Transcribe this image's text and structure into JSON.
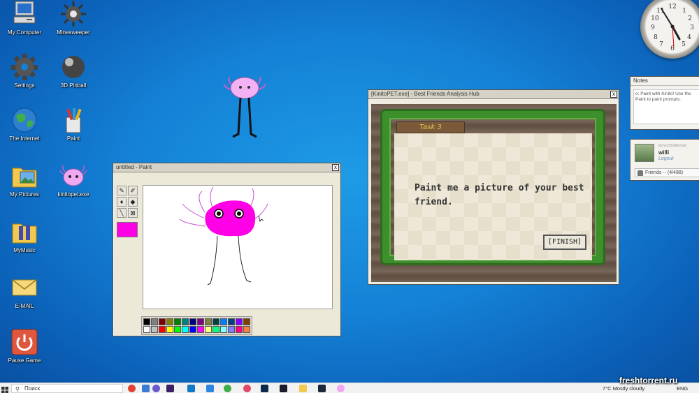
{
  "desktop_icons": [
    {
      "label": "My Computer",
      "icon": "computer-icon"
    },
    {
      "label": "Minesweeper",
      "icon": "mine-icon"
    },
    {
      "label": "Settings",
      "icon": "gear-icon"
    },
    {
      "label": "3D Pinball",
      "icon": "ball-icon"
    },
    {
      "label": "The Internet",
      "icon": "globe-icon"
    },
    {
      "label": "Paint",
      "icon": "paint-bucket-icon"
    },
    {
      "label": "My Pictures",
      "icon": "pictures-folder-icon"
    },
    {
      "label": "kinitopet.exe",
      "icon": "kinito-pet-icon"
    },
    {
      "label": "MyMusic",
      "icon": "music-folder-icon"
    },
    {
      "label": "E-MAIL",
      "icon": "envelope-icon"
    },
    {
      "label": "Pause Game",
      "icon": "power-icon"
    }
  ],
  "paint_window": {
    "title": "untitled - Paint",
    "close": "x",
    "current_color": "#ff00e6",
    "palette": [
      "#000000",
      "#808080",
      "#800000",
      "#808000",
      "#008000",
      "#008080",
      "#000080",
      "#800080",
      "#808040",
      "#004040",
      "#0080ff",
      "#004080",
      "#8000ff",
      "#804000",
      "#ffffff",
      "#c0c0c0",
      "#ff0000",
      "#ffff00",
      "#00ff00",
      "#00ffff",
      "#0000ff",
      "#ff00ff",
      "#ffff80",
      "#00ff80",
      "#80ffff",
      "#8080ff",
      "#ff0080",
      "#ff8040"
    ]
  },
  "kinito_window": {
    "title": "[KinitoPET.exe] - Best Friends Analysis Hub",
    "close": "x",
    "task_label": "Task 3",
    "prompt": "Paint me a picture of your best friend.",
    "finish_label": "[FINISH]"
  },
  "notes_widget": {
    "title": "Notes",
    "text": "o: Paint with Kinito! Use the Paint to paint prompts."
  },
  "friends_widget": {
    "user_small": "idmsx5528email",
    "username": "willi",
    "logout_label": "Logout",
    "friends_label": "Friends -- (4/488)"
  },
  "taskbar": {
    "search_placeholder": "Поиск",
    "weather": "7°C  Mostly cloudy",
    "language": "ENG"
  },
  "watermark": "freshtorrent.ru"
}
